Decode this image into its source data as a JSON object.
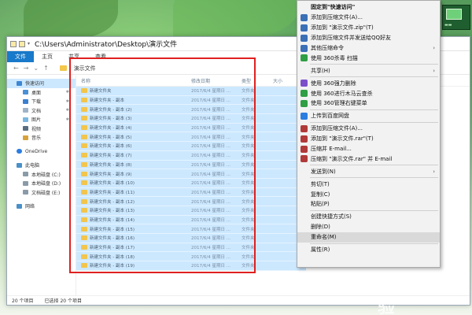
{
  "window": {
    "title": "C:\\Users\\Administrator\\Desktop\\演示文件",
    "ribbon_tabs": [
      "文件",
      "主页",
      "共享",
      "查看"
    ],
    "breadcrumb": "演示文件"
  },
  "sidebar": {
    "quick_access": "快速访问",
    "items": [
      {
        "label": "桌面",
        "pinned": true
      },
      {
        "label": "下载",
        "pinned": true
      },
      {
        "label": "文档",
        "pinned": true
      },
      {
        "label": "图片",
        "pinned": true
      },
      {
        "label": "视频",
        "pinned": false
      },
      {
        "label": "音乐",
        "pinned": false
      }
    ],
    "onedrive": "OneDrive",
    "this_pc": "此电脑",
    "drives": [
      "本地磁盘 (C:)",
      "本地磁盘 (D:)",
      "文档磁盘 (E:)"
    ],
    "network": "网络"
  },
  "columns": {
    "name": "名称",
    "date": "修改日期",
    "type": "类型",
    "size": "大小"
  },
  "files": [
    {
      "name": "新建文件夹",
      "date": "2017/6/4 星期日 ...",
      "type": "文件夹"
    },
    {
      "name": "新建文件夹 - 副本",
      "date": "2017/6/4 星期日 ...",
      "type": "文件夹"
    },
    {
      "name": "新建文件夹 - 副本 (2)",
      "date": "2017/6/4 星期日 ...",
      "type": "文件夹"
    },
    {
      "name": "新建文件夹 - 副本 (3)",
      "date": "2017/6/4 星期日 ...",
      "type": "文件夹"
    },
    {
      "name": "新建文件夹 - 副本 (4)",
      "date": "2017/6/4 星期日 ...",
      "type": "文件夹"
    },
    {
      "name": "新建文件夹 - 副本 (5)",
      "date": "2017/6/4 星期日 ...",
      "type": "文件夹"
    },
    {
      "name": "新建文件夹 - 副本 (6)",
      "date": "2017/6/4 星期日 ...",
      "type": "文件夹"
    },
    {
      "name": "新建文件夹 - 副本 (7)",
      "date": "2017/6/4 星期日 ...",
      "type": "文件夹"
    },
    {
      "name": "新建文件夹 - 副本 (8)",
      "date": "2017/6/4 星期日 ...",
      "type": "文件夹"
    },
    {
      "name": "新建文件夹 - 副本 (9)",
      "date": "2017/6/4 星期日 ...",
      "type": "文件夹"
    },
    {
      "name": "新建文件夹 - 副本 (10)",
      "date": "2017/6/4 星期日 ...",
      "type": "文件夹"
    },
    {
      "name": "新建文件夹 - 副本 (11)",
      "date": "2017/6/4 星期日 ...",
      "type": "文件夹"
    },
    {
      "name": "新建文件夹 - 副本 (12)",
      "date": "2017/6/4 星期日 ...",
      "type": "文件夹"
    },
    {
      "name": "新建文件夹 - 副本 (13)",
      "date": "2017/6/4 星期日 ...",
      "type": "文件夹"
    },
    {
      "name": "新建文件夹 - 副本 (14)",
      "date": "2017/6/4 星期日 ...",
      "type": "文件夹"
    },
    {
      "name": "新建文件夹 - 副本 (15)",
      "date": "2017/6/4 星期日 ...",
      "type": "文件夹"
    },
    {
      "name": "新建文件夹 - 副本 (16)",
      "date": "2017/6/4 星期日 ...",
      "type": "文件夹"
    },
    {
      "name": "新建文件夹 - 副本 (17)",
      "date": "2017/6/4 星期日 ...",
      "type": "文件夹"
    },
    {
      "name": "新建文件夹 - 副本 (18)",
      "date": "2017/6/4 星期日 ...",
      "type": "文件夹"
    },
    {
      "name": "新建文件夹 - 副本 (19)",
      "date": "2017/6/4 星期日 ...",
      "type": "文件夹"
    }
  ],
  "status": {
    "count": "20 个项目",
    "selected": "已选择 20 个项目"
  },
  "context_menu": [
    {
      "type": "item",
      "label": "固定到\"快速访问\"",
      "icon": "none",
      "bold": true
    },
    {
      "type": "item",
      "label": "添加到压缩文件(A)...",
      "icon": "archive-icon",
      "color": "#3b6fb6"
    },
    {
      "type": "item",
      "label": "添加到 \"演示文件.zip\"(T)",
      "icon": "archive-icon",
      "color": "#3b6fb6"
    },
    {
      "type": "item",
      "label": "添加到压缩文件并发送给QQ好友",
      "icon": "archive-icon",
      "color": "#3b6fb6"
    },
    {
      "type": "item",
      "label": "其他压缩命令",
      "icon": "archive-icon",
      "color": "#3b6fb6",
      "submenu": true
    },
    {
      "type": "item",
      "label": "使用 360杀毒 扫描",
      "icon": "shield-icon",
      "color": "#2f9e44"
    },
    {
      "type": "sep"
    },
    {
      "type": "item",
      "label": "共享(H)",
      "icon": "none",
      "submenu": true
    },
    {
      "type": "sep"
    },
    {
      "type": "item",
      "label": "使用 360强力删除",
      "icon": "shield-icon",
      "color": "#7b4fc9"
    },
    {
      "type": "item",
      "label": "使用 360进行木马云查杀",
      "icon": "shield-icon",
      "color": "#2f9e44"
    },
    {
      "type": "item",
      "label": "使用 360管理右键菜单",
      "icon": "shield-icon",
      "color": "#2f9e44"
    },
    {
      "type": "sep"
    },
    {
      "type": "item",
      "label": "上传到百度网盘",
      "icon": "cloud-icon",
      "color": "#2b7de0"
    },
    {
      "type": "sep"
    },
    {
      "type": "item",
      "label": "添加到压缩文件(A)...",
      "icon": "archive-icon",
      "color": "#b03a3a"
    },
    {
      "type": "item",
      "label": "添加到 \"演示文件.rar\"(T)",
      "icon": "archive-icon",
      "color": "#b03a3a"
    },
    {
      "type": "item",
      "label": "压缩并 E-mail...",
      "icon": "archive-icon",
      "color": "#b03a3a"
    },
    {
      "type": "item",
      "label": "压缩到 \"演示文件.rar\" 并 E-mail",
      "icon": "archive-icon",
      "color": "#b03a3a"
    },
    {
      "type": "sep"
    },
    {
      "type": "item",
      "label": "发送到(N)",
      "icon": "none",
      "submenu": true
    },
    {
      "type": "sep"
    },
    {
      "type": "item",
      "label": "剪切(T)",
      "icon": "none"
    },
    {
      "type": "item",
      "label": "复制(C)",
      "icon": "none"
    },
    {
      "type": "item",
      "label": "粘贴(P)",
      "icon": "none"
    },
    {
      "type": "sep"
    },
    {
      "type": "item",
      "label": "创建快捷方式(S)",
      "icon": "none"
    },
    {
      "type": "item",
      "label": "删除(D)",
      "icon": "none"
    },
    {
      "type": "item",
      "label": "重命名(M)",
      "icon": "none",
      "highlight": true
    },
    {
      "type": "sep"
    },
    {
      "type": "item",
      "label": "属性(R)",
      "icon": "none"
    }
  ],
  "watermark": {
    "brand": "Bai du 经验",
    "url": "jingyan.baidu.com"
  },
  "colors": {
    "selection": "#cce8ff",
    "accent": "#1979ca",
    "redbox": "#e02020"
  }
}
